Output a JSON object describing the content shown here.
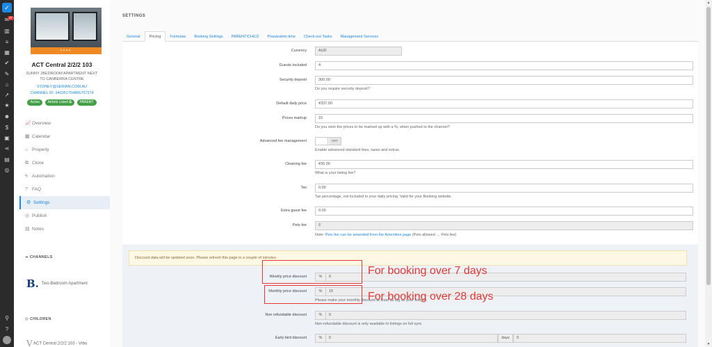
{
  "rail": {
    "notification_count": "37",
    "icons": [
      "inbox-icon",
      "stats-icon",
      "calendar-icon",
      "list-icon",
      "check-icon",
      "brush-icon",
      "home-icon",
      "rocket-icon",
      "star-icon",
      "users-icon",
      "dollar-icon",
      "briefcase-icon",
      "share-icon",
      "grid-icon",
      "globe-icon"
    ]
  },
  "property": {
    "title": "ACT Central 2/2/2 103",
    "subtitle": "SUNNY 2BEDROOM APARTMENT NEXT TO CANBERRA CENTRE",
    "email": "SYDNEY@SERIAN.COM.AU",
    "channel_id": "CHANNEL ID: 940251754866707374",
    "badges": [
      "Active",
      "Airbnb Listed",
      "PARENT"
    ]
  },
  "nav": [
    {
      "label": "Overview",
      "icon": "chart-icon"
    },
    {
      "label": "Calendar",
      "icon": "calendar-icon"
    },
    {
      "label": "Property",
      "icon": "home-icon"
    },
    {
      "label": "Clone",
      "icon": "clone-icon"
    },
    {
      "label": "Automation",
      "icon": "bolt-icon"
    },
    {
      "label": "FAQ",
      "icon": "question-icon"
    },
    {
      "label": "Settings",
      "icon": "gear-icon"
    },
    {
      "label": "Publish",
      "icon": "globe-icon"
    },
    {
      "label": "Notes",
      "icon": "note-icon"
    }
  ],
  "channels": {
    "heading": "CHANNELS",
    "items": [
      {
        "logo": "B.",
        "name": "Two-Bedroom Apartment"
      }
    ]
  },
  "children": {
    "heading": "CHILDREN",
    "items": [
      {
        "logo": "V",
        "name": "ACT Central 2/2/2 103 - Vrbo"
      }
    ]
  },
  "page": {
    "title": "SETTINGS",
    "tabs": [
      "General",
      "Pricing",
      "Formulas",
      "Booking Settings",
      "PARENT/CHILD",
      "Preparation time",
      "Check-out Tasks",
      "Management Services"
    ],
    "active_tab": "Pricing"
  },
  "form": {
    "currency": {
      "label": "Currency",
      "value": "AUD"
    },
    "guests": {
      "label": "Guests included",
      "value": "4"
    },
    "deposit": {
      "label": "Security deposit",
      "value": "300.00",
      "help": "Do you require security deposit?"
    },
    "daily_price": {
      "label": "Default daily price",
      "value": "¥337.00"
    },
    "markup": {
      "label": "Prices markup",
      "value": "15",
      "help": "Do you wish the prices to be marked up with a %, when pushed to the channel?"
    },
    "advanced_fee": {
      "label": "Advanced fee management",
      "state": "OFF",
      "help": "Enable advanced standard fees, taxes and extras."
    },
    "cleaning": {
      "label": "Cleaning fee",
      "value": "¥35.00",
      "help": "What is your listing fee?"
    },
    "tax": {
      "label": "Tax",
      "value": "0.00",
      "help": "Tax percentage, not included in your daily pricing. Valid for your Booking website."
    },
    "extra_guest": {
      "label": "Extra guest fee",
      "value": "0.00"
    },
    "pets": {
      "label": "Pets fee",
      "value": "0",
      "help_prefix": "Note: ",
      "help_link": "Pets fee can be amended from the Amenities page",
      "help_suffix": " (Pets allowed → Pets fee)"
    }
  },
  "discounts": {
    "alert": "Discount data will be updated soon. Please refresh this page in a couple of minutes.",
    "weekly": {
      "label": "Weekly price discount",
      "unit": "%",
      "value": "0"
    },
    "monthly": {
      "label": "Monthly price discount",
      "unit": "%",
      "value": "15",
      "help": "Please make your monthly discount at least as big as your weekly."
    },
    "non_refundable": {
      "label": "Non refundable discount",
      "unit": "%",
      "value": "0",
      "help": "Non-refundable discount is only available to listings on full sync"
    },
    "early_bird": {
      "label": "Early bird discount",
      "unit": "%",
      "value": "0",
      "days_label": "days",
      "days_value": "0"
    }
  },
  "annotations": {
    "weekly_note": "For booking over 7 days",
    "monthly_note": "For booking over 28 days",
    "color": "#e53935"
  }
}
